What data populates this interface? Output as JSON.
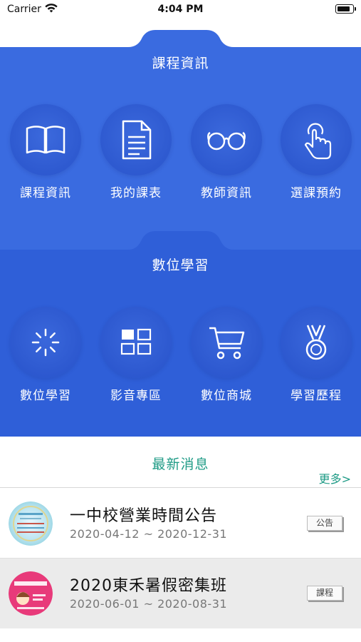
{
  "status_bar": {
    "carrier": "Carrier",
    "time": "4:04 PM",
    "battery_level": 0.9
  },
  "colors": {
    "primary_blue": "#3a6be0",
    "secondary_blue": "#2f5fd8",
    "accent_green": "#1f9b86"
  },
  "course_section": {
    "title": "課程資訊",
    "items": [
      {
        "label": "課程資訊",
        "icon": "book-icon"
      },
      {
        "label": "我的課表",
        "icon": "document-icon"
      },
      {
        "label": "教師資訊",
        "icon": "glasses-icon"
      },
      {
        "label": "選課預約",
        "icon": "tap-hand-icon"
      }
    ]
  },
  "digital_section": {
    "title": "數位學習",
    "items": [
      {
        "label": "數位學習",
        "icon": "loading-spinner-icon"
      },
      {
        "label": "影音專區",
        "icon": "grid-icon"
      },
      {
        "label": "數位商城",
        "icon": "cart-icon"
      },
      {
        "label": "學習歷程",
        "icon": "medal-icon"
      }
    ]
  },
  "news": {
    "title": "最新消息",
    "more_label": "更多>",
    "items": [
      {
        "headline": "一中校營業時間公告",
        "dates": "2020-04-12 ~ 2020-12-31",
        "tag": "公告",
        "thumb_icon": "announcement-thumbnail"
      },
      {
        "headline": "2020東禾暑假密集班",
        "dates": "2020-06-01 ~ 2020-08-31",
        "tag": "課程",
        "thumb_icon": "summer-class-thumbnail"
      }
    ]
  }
}
